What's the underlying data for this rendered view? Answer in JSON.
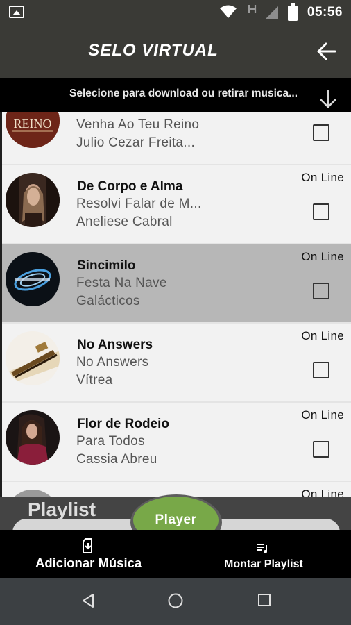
{
  "status_bar": {
    "time": "05:56",
    "icons": [
      "image-notification-icon",
      "wifi-icon",
      "h-signal-icon",
      "cell-signal-icon",
      "battery-icon"
    ]
  },
  "app_bar": {
    "title": "SELO VIRTUAL",
    "back_icon": "arrow-back-icon"
  },
  "sub_bar": {
    "text": "Selecione para download ou retirar musica...",
    "icon": "arrow-down-icon"
  },
  "songs": [
    {
      "title": "",
      "album": "Venha Ao Teu Reino",
      "artist": "Julio Cezar Freita...",
      "status": "",
      "selected": false
    },
    {
      "title": "De Corpo e Alma",
      "album": "Resolvi Falar de M...",
      "artist": "Aneliese Cabral",
      "status": "On Line",
      "selected": false
    },
    {
      "title": "Sincimilo",
      "album": "Festa Na Nave",
      "artist": "Galácticos",
      "status": "On Line",
      "selected": true
    },
    {
      "title": "No Answers",
      "album": "No Answers",
      "artist": "Vítrea",
      "status": "On Line",
      "selected": false
    },
    {
      "title": "Flor de Rodeio",
      "album": "Para Todos",
      "artist": "Cassia Abreu",
      "status": "On Line",
      "selected": false
    },
    {
      "title": "",
      "album": "",
      "artist": "",
      "status": "On Line",
      "selected": false
    }
  ],
  "cover_texts": {
    "reino": "REINO"
  },
  "playlist": {
    "title": "Playlist"
  },
  "player": {
    "label": "Player"
  },
  "bottom_nav": [
    {
      "label": "Adicionar Música",
      "icon": "add-music-icon"
    },
    {
      "label": "Montar Playlist",
      "icon": "playlist-icon"
    }
  ],
  "colors": {
    "app_bar": "#3a3a36",
    "player_button": "#78a848",
    "selected_row": "#b7b7b7"
  }
}
